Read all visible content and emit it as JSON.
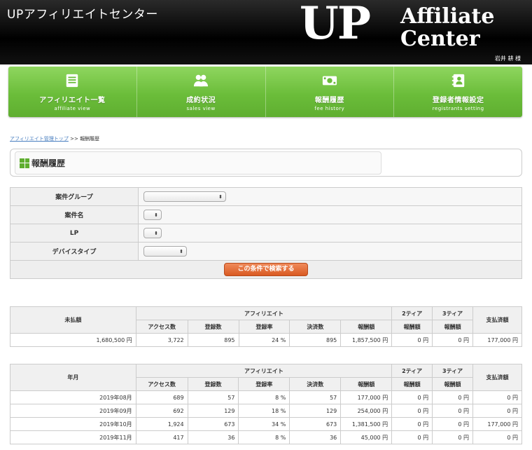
{
  "header": {
    "site_title": "UPアフィリエイトセンター",
    "logo": {
      "up": "UP",
      "line1": "Affiliate",
      "line2": "Center"
    },
    "user_name": "岩井 耕 様"
  },
  "nav": [
    {
      "label": "アフィリエイト一覧",
      "sub": "affiliate view",
      "icon": "list-icon"
    },
    {
      "label": "成約状況",
      "sub": "sales view",
      "icon": "users-icon"
    },
    {
      "label": "報酬履歴",
      "sub": "fee history",
      "icon": "money-icon"
    },
    {
      "label": "登録者情報設定",
      "sub": "registrants setting",
      "icon": "address-book-icon"
    }
  ],
  "breadcrumb": {
    "link": "アフィリエイト管理トップ",
    "sep": " >> ",
    "current": "報酬履歴"
  },
  "page_title": "報酬履歴",
  "search": {
    "fields": [
      {
        "label": "案件グループ",
        "value": ""
      },
      {
        "label": "案件名",
        "value": ""
      },
      {
        "label": "LP",
        "value": ""
      },
      {
        "label": "デバイスタイプ",
        "value": ""
      }
    ],
    "button": "この条件で検索する"
  },
  "headers": {
    "affiliate": "アフィリエイト",
    "tier2": "2ティア",
    "tier3": "3ティア",
    "paid": "支払済額",
    "access": "アクセス数",
    "registrations": "登録数",
    "reg_rate": "登録率",
    "settlements": "決済数",
    "fee": "報酬額"
  },
  "unpaid_table": {
    "row_header": "未払額",
    "row": [
      "1,680,500 円",
      "3,722",
      "895",
      "24 %",
      "895",
      "1,857,500 円",
      "0 円",
      "0 円",
      "177,000 円"
    ]
  },
  "monthly_table": {
    "row_header": "年月",
    "rows": [
      [
        "2019年08月",
        "689",
        "57",
        "8 %",
        "57",
        "177,000 円",
        "0 円",
        "0 円",
        "0 円"
      ],
      [
        "2019年09月",
        "692",
        "129",
        "18 %",
        "129",
        "254,000 円",
        "0 円",
        "0 円",
        "0 円"
      ],
      [
        "2019年10月",
        "1,924",
        "673",
        "34 %",
        "673",
        "1,381,500 円",
        "0 円",
        "0 円",
        "177,000 円"
      ],
      [
        "2019年11月",
        "417",
        "36",
        "8 %",
        "36",
        "45,000 円",
        "0 円",
        "0 円",
        "0 円"
      ]
    ]
  }
}
